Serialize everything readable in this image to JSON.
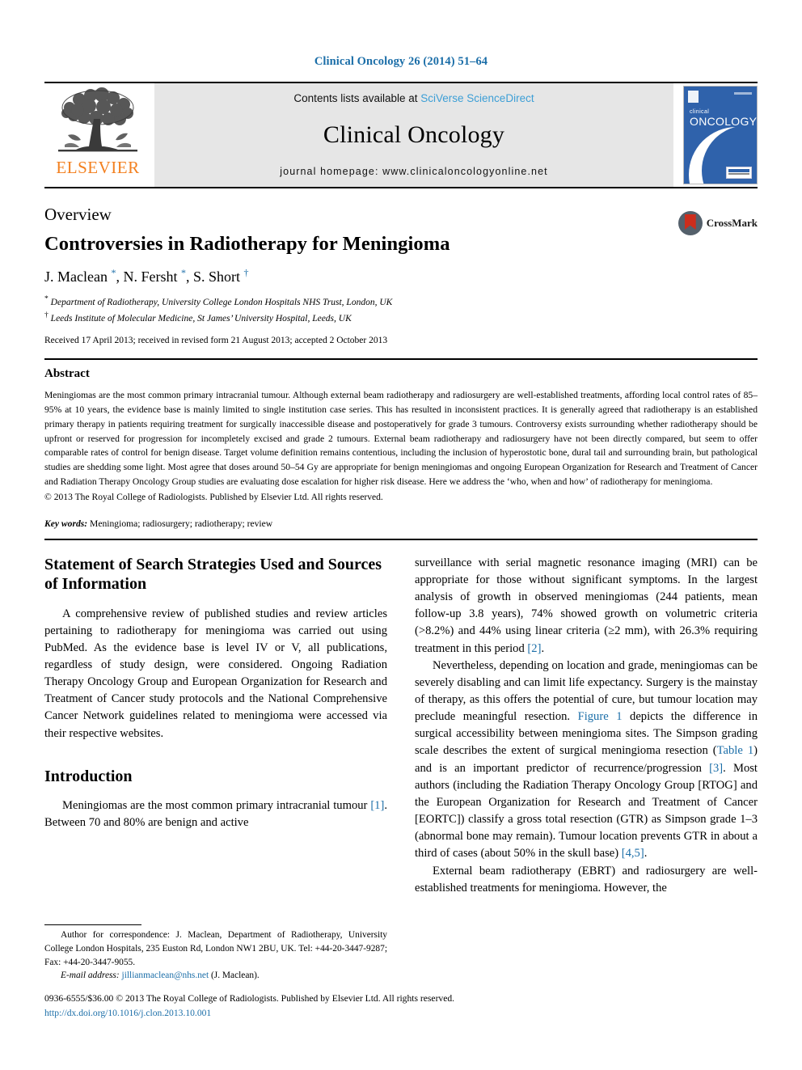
{
  "running_head": "Clinical Oncology 26 (2014) 51–64",
  "masthead": {
    "publisher": "ELSEVIER",
    "contents_prefix": "Contents lists available at ",
    "contents_link": "SciVerse ScienceDirect",
    "journal_name": "Clinical Oncology",
    "homepage": "journal homepage: www.clinicaloncologyonline.net",
    "cover_title_small": "clinical",
    "cover_title_big": "ONCOLOGY"
  },
  "article": {
    "kicker": "Overview",
    "title": "Controversies in Radiotherapy for Meningioma",
    "authors": "J. Maclean *, N. Fersht *, S. Short †",
    "affiliation_1": "* Department of Radiotherapy, University College London Hospitals NHS Trust, London, UK",
    "affiliation_2": "† Leeds Institute of Molecular Medicine, St James’ University Hospital, Leeds, UK",
    "dates": "Received 17 April 2013; received in revised form 21 August 2013; accepted 2 October 2013",
    "crossmark_label": "CrossMark"
  },
  "abstract": {
    "heading": "Abstract",
    "text": "Meningiomas are the most common primary intracranial tumour. Although external beam radiotherapy and radiosurgery are well-established treatments, affording local control rates of 85–95% at 10 years, the evidence base is mainly limited to single institution case series. This has resulted in inconsistent practices. It is generally agreed that radiotherapy is an established primary therapy in patients requiring treatment for surgically inaccessible disease and postoperatively for grade 3 tumours. Controversy exists surrounding whether radiotherapy should be upfront or reserved for progression for incompletely excised and grade 2 tumours. External beam radiotherapy and radiosurgery have not been directly compared, but seem to offer comparable rates of control for benign disease. Target volume definition remains contentious, including the inclusion of hyperostotic bone, dural tail and surrounding brain, but pathological studies are shedding some light. Most agree that doses around 50–54 Gy are appropriate for benign meningiomas and ongoing European Organization for Research and Treatment of Cancer and Radiation Therapy Oncology Group studies are evaluating dose escalation for higher risk disease. Here we address the ‘who, when and how’ of radiotherapy for meningioma.",
    "copyright": "© 2013 The Royal College of Radiologists. Published by Elsevier Ltd. All rights reserved.",
    "keywords_label": "Key words:",
    "keywords_value": " Meningioma; radiosurgery; radiotherapy; review"
  },
  "left_column": {
    "section1_heading": "Statement of Search Strategies Used and Sources of Information",
    "section1_paragraph": "A comprehensive review of published studies and review articles pertaining to radiotherapy for meningioma was carried out using PubMed. As the evidence base is level IV or V, all publications, regardless of study design, were considered. Ongoing Radiation Therapy Oncology Group and European Organization for Research and Treatment of Cancer study protocols and the National Comprehensive Cancer Network guidelines related to meningioma were accessed via their respective websites.",
    "section2_heading": "Introduction",
    "section2_part1": "Meningiomas are the most common primary intracranial tumour ",
    "section2_ref": "[1]",
    "section2_part2": ". Between 70 and 80% are benign and active"
  },
  "right_column": {
    "para1_part1": "surveillance with serial magnetic resonance imaging (MRI) can be appropriate for those without significant symptoms. In the largest analysis of growth in observed meningiomas (244 patients, mean follow-up 3.8 years), 74% showed growth on volumetric criteria (>8.2%) and 44% using linear criteria (≥2 mm), with 26.3% requiring treatment in this period ",
    "para1_ref": "[2]",
    "para1_part2": ".",
    "para2_part1": "Nevertheless, depending on location and grade, meningiomas can be severely disabling and can limit life expectancy. Surgery is the mainstay of therapy, as this offers the potential of cure, but tumour location may preclude meaningful resection. ",
    "para2_figref": "Figure 1",
    "para2_part2": " depicts the difference in surgical accessibility between meningioma sites. The Simpson grading scale describes the extent of surgical meningioma resection (",
    "para2_tableref": "Table 1",
    "para2_part3": ") and is an important predictor of recurrence/progression ",
    "para2_ref3": "[3]",
    "para2_part4": ". Most authors (including the Radiation Therapy Oncology Group [RTOG] and the European Organization for Research and Treatment of Cancer [EORTC]) classify a gross total resection (GTR) as Simpson grade 1–3 (abnormal bone may remain). Tumour location prevents GTR in about a third of cases (about 50% in the skull base) ",
    "para2_ref45": "[4,5]",
    "para2_part5": ".",
    "para3": "External beam radiotherapy (EBRT) and radiosurgery are well-established treatments for meningioma. However, the"
  },
  "footnote": {
    "line1": "Author for correspondence: J. Maclean, Department of Radiotherapy, University College London Hospitals, 235 Euston Rd, London NW1 2BU, UK. Tel: +44-20-3447-9287; Fax: +44-20-3447-9055.",
    "email_label": "E-mail address:",
    "email": "jillianmaclean@nhs.net",
    "email_suffix": " (J. Maclean)."
  },
  "page_footer": {
    "issn_line": "0936-6555/$36.00 © 2013 The Royal College of Radiologists. Published by Elsevier Ltd. All rights reserved.",
    "doi": "http://dx.doi.org/10.1016/j.clon.2013.10.001"
  },
  "colors": {
    "link_blue": "#1b6ea8",
    "sciencedirect_blue": "#3d9fd6",
    "elsevier_orange": "#f3801f",
    "cover_blue": "#2f62ab",
    "crossmark_red": "#cc2d1c"
  }
}
